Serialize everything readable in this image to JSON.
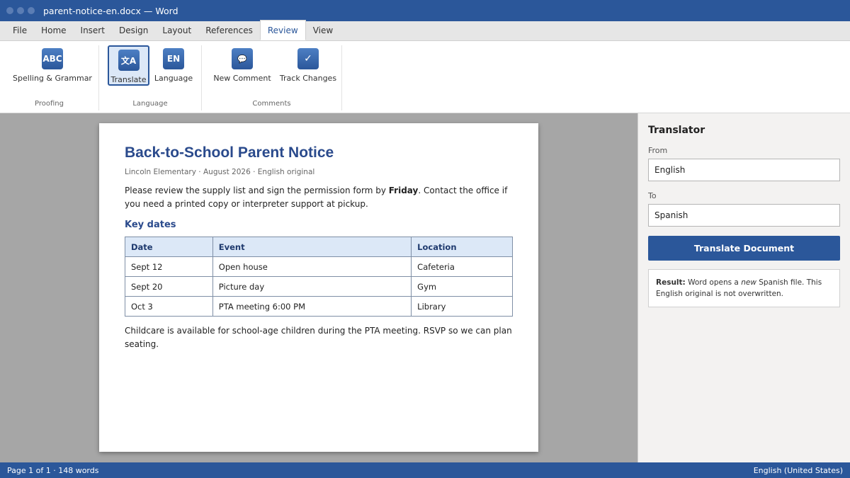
{
  "window": {
    "title": "parent-notice-en.docx — Word"
  },
  "tabs": [
    "File",
    "Home",
    "Insert",
    "Design",
    "Layout",
    "References",
    "Review",
    "View"
  ],
  "ribbon": {
    "proofing": {
      "label": "Proofing",
      "spelling": {
        "icon": "ABC",
        "label": "Spelling & Grammar"
      }
    },
    "language": {
      "label": "Language",
      "translate": {
        "icon": "文A",
        "label": "Translate"
      },
      "language": {
        "icon": "EN",
        "label": "Language"
      }
    },
    "comments": {
      "label": "Comments",
      "new_comment": {
        "icon": "💬",
        "label": "New Comment"
      },
      "track_changes": {
        "icon": "✓",
        "label": "Track Changes"
      }
    }
  },
  "document": {
    "title": "Back-to-School Parent Notice",
    "meta": "Lincoln Elementary · August 2026 · English original",
    "para1_before": "Please review the supply list and sign the permission form by ",
    "para1_bold": "Friday",
    "para1_after": ". Contact the office if you need a printed copy or interpreter support at pickup.",
    "heading": "Key dates",
    "table": {
      "headers": [
        "Date",
        "Event",
        "Location"
      ],
      "rows": [
        [
          "Sept 12",
          "Open house",
          "Cafeteria"
        ],
        [
          "Sept 20",
          "Picture day",
          "Gym"
        ],
        [
          "Oct 3",
          "PTA meeting 6:00 PM",
          "Library"
        ]
      ]
    },
    "para2": "Childcare is available for school-age children during the PTA meeting. RSVP so we can plan seating."
  },
  "translator": {
    "title": "Translator",
    "from_label": "From",
    "from_value": "English",
    "to_label": "To",
    "to_value": "Spanish",
    "button": "Translate Document",
    "result_bold": "Result:",
    "result_pre": " Word opens a ",
    "result_em": "new",
    "result_post": " Spanish file. This English original is not overwritten."
  },
  "status": {
    "left": "Page 1 of 1 · 148 words",
    "right": "English (United States)"
  },
  "colors": {
    "accent": "#2b579a",
    "heading": "#2a4a8c",
    "table_header": "#dce8f7"
  }
}
